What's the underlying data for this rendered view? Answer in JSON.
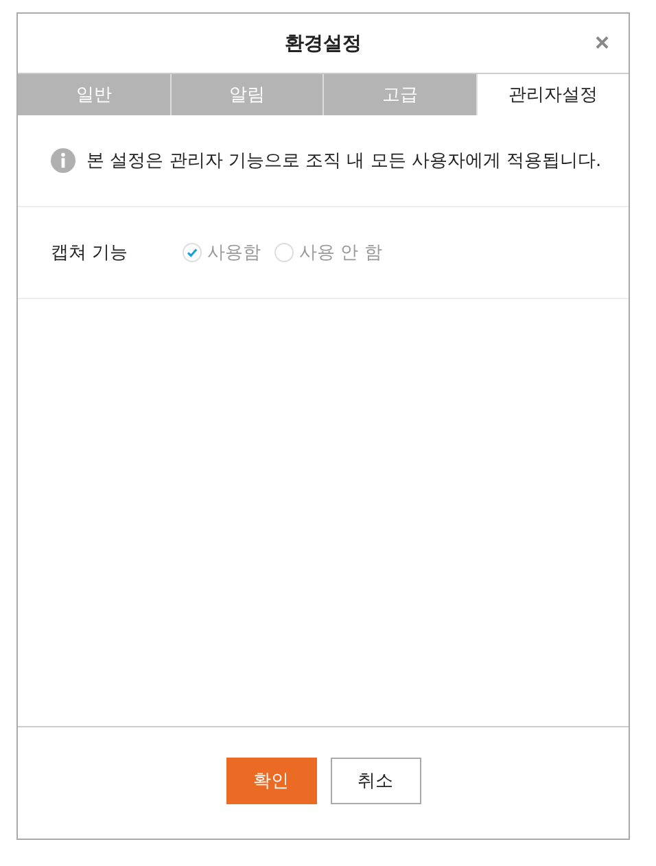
{
  "dialog": {
    "title": "환경설정",
    "close": "×"
  },
  "tabs": [
    {
      "label": "일반",
      "selected": false
    },
    {
      "label": "알림",
      "selected": false
    },
    {
      "label": "고급",
      "selected": false
    },
    {
      "label": "관리자설정",
      "selected": true
    }
  ],
  "notice": {
    "text": "본 설정은 관리자 기능으로 조직 내 모든 사용자에게 적용됩니다."
  },
  "settings": [
    {
      "label": "캡쳐 기능",
      "options": [
        {
          "label": "사용함",
          "selected": true
        },
        {
          "label": "사용 안 함",
          "selected": false
        }
      ]
    }
  ],
  "buttons": [
    {
      "label": "확인",
      "kind": "primary"
    },
    {
      "label": "취소",
      "kind": "secondary"
    }
  ]
}
